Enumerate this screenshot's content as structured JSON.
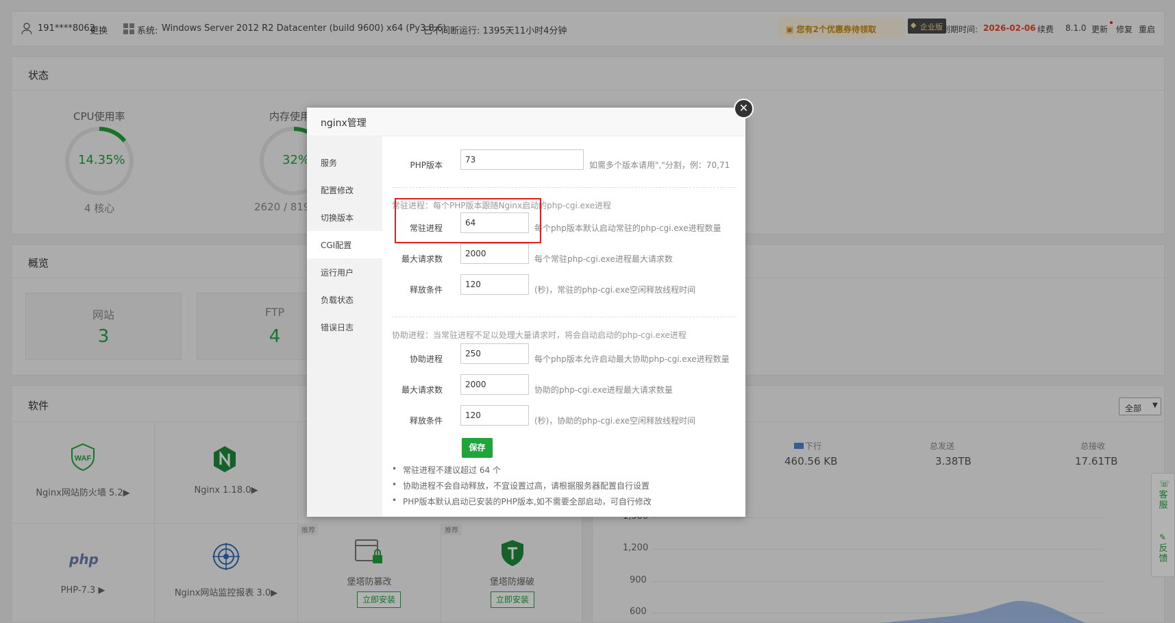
{
  "topbar": {
    "user": "191****8062",
    "change": "更换",
    "system_label": "系统:",
    "system": "Windows Server 2012 R2 Datacenter (build 9600) x64 (Py3.8.6)",
    "uptime": "已不间断运行: 1395天11小时4分钟",
    "coupon": "您有2个优惠券待领取",
    "edition": "企业版",
    "expiry_label": "到期时间:",
    "expiry": "2026-02-06",
    "renew": "续费",
    "version": "8.1.0",
    "update": "更新",
    "repair": "修复",
    "restart": "重启"
  },
  "status": {
    "title": "状态",
    "cpu": {
      "label": "CPU使用率",
      "value": "14.35%",
      "sub": "4 核心",
      "fraction": 0.1435
    },
    "mem": {
      "label": "内存使用",
      "value": "32%",
      "sub": "2620 / 819",
      "fraction": 0.32
    }
  },
  "overview": {
    "title": "概览",
    "site_label": "网站",
    "site_count": "3",
    "ftp_label": "FTP",
    "ftp_count": "4"
  },
  "software": {
    "title": "软件",
    "filter": "全部",
    "items": [
      {
        "name": "Nginx网站防火墙 5.2▶"
      },
      {
        "name": "Nginx 1.18.0▶"
      },
      {
        "name": "PHP-7.3 ▶"
      },
      {
        "name": "Nginx网站监控报表 3.0▶"
      },
      {
        "name": "堡塔防篡改",
        "tag": "推荐",
        "btn": "立即安装"
      },
      {
        "name": "堡塔防爆破",
        "tag": "推荐",
        "btn": "立即安装"
      }
    ]
  },
  "traffic": {
    "down_label": "下行",
    "down_value": "460.56 KB",
    "sent_label": "总发送",
    "sent_value": "3.38TB",
    "recv_label": "总接收",
    "recv_value": "17.61TB",
    "yticks": [
      "1,500",
      "1,200",
      "900",
      "600"
    ]
  },
  "side": {
    "service": "客服",
    "feedback": "反馈"
  },
  "modal": {
    "title": "nginx管理",
    "nav": [
      "服务",
      "配置修改",
      "切换版本",
      "CGI配置",
      "运行用户",
      "负载状态",
      "错误日志"
    ],
    "active_index": 3,
    "php_label": "PHP版本",
    "php_value": "73",
    "php_hint": "如需多个版本请用\",\"分割，例：70,71",
    "resident_title": "常驻进程：每个PHP版本跟随Nginx启动的php-cgi.exe进程",
    "resident": [
      {
        "label": "常驻进程",
        "value": "64",
        "hint": "每个php版本默认启动常驻的php-cgi.exe进程数量"
      },
      {
        "label": "最大请求数",
        "value": "2000",
        "hint": "每个常驻php-cgi.exe进程最大请求数"
      },
      {
        "label": "释放条件",
        "value": "120",
        "hint": "(秒)，常驻的php-cgi.exe空闲释放线程时间"
      }
    ],
    "assist_title": "协助进程：当常驻进程不足以处理大量请求时，将会自动启动的php-cgi.exe进程",
    "assist": [
      {
        "label": "协助进程",
        "value": "250",
        "hint": "每个php版本允许启动最大协助php-cgi.exe进程数量"
      },
      {
        "label": "最大请求数",
        "value": "2000",
        "hint": "协助的php-cgi.exe进程最大请求数量"
      },
      {
        "label": "释放条件",
        "value": "120",
        "hint": "(秒)，协助的php-cgi.exe空闲释放线程时间"
      }
    ],
    "save": "保存",
    "tips": [
      "常驻进程不建议超过 64 个",
      "协助进程不会自动释放，不宜设置过高，请根据服务器配置自行设置",
      "PHP版本默认启动已安装的PHP版本,如不需要全部启动，可自行修改"
    ]
  }
}
